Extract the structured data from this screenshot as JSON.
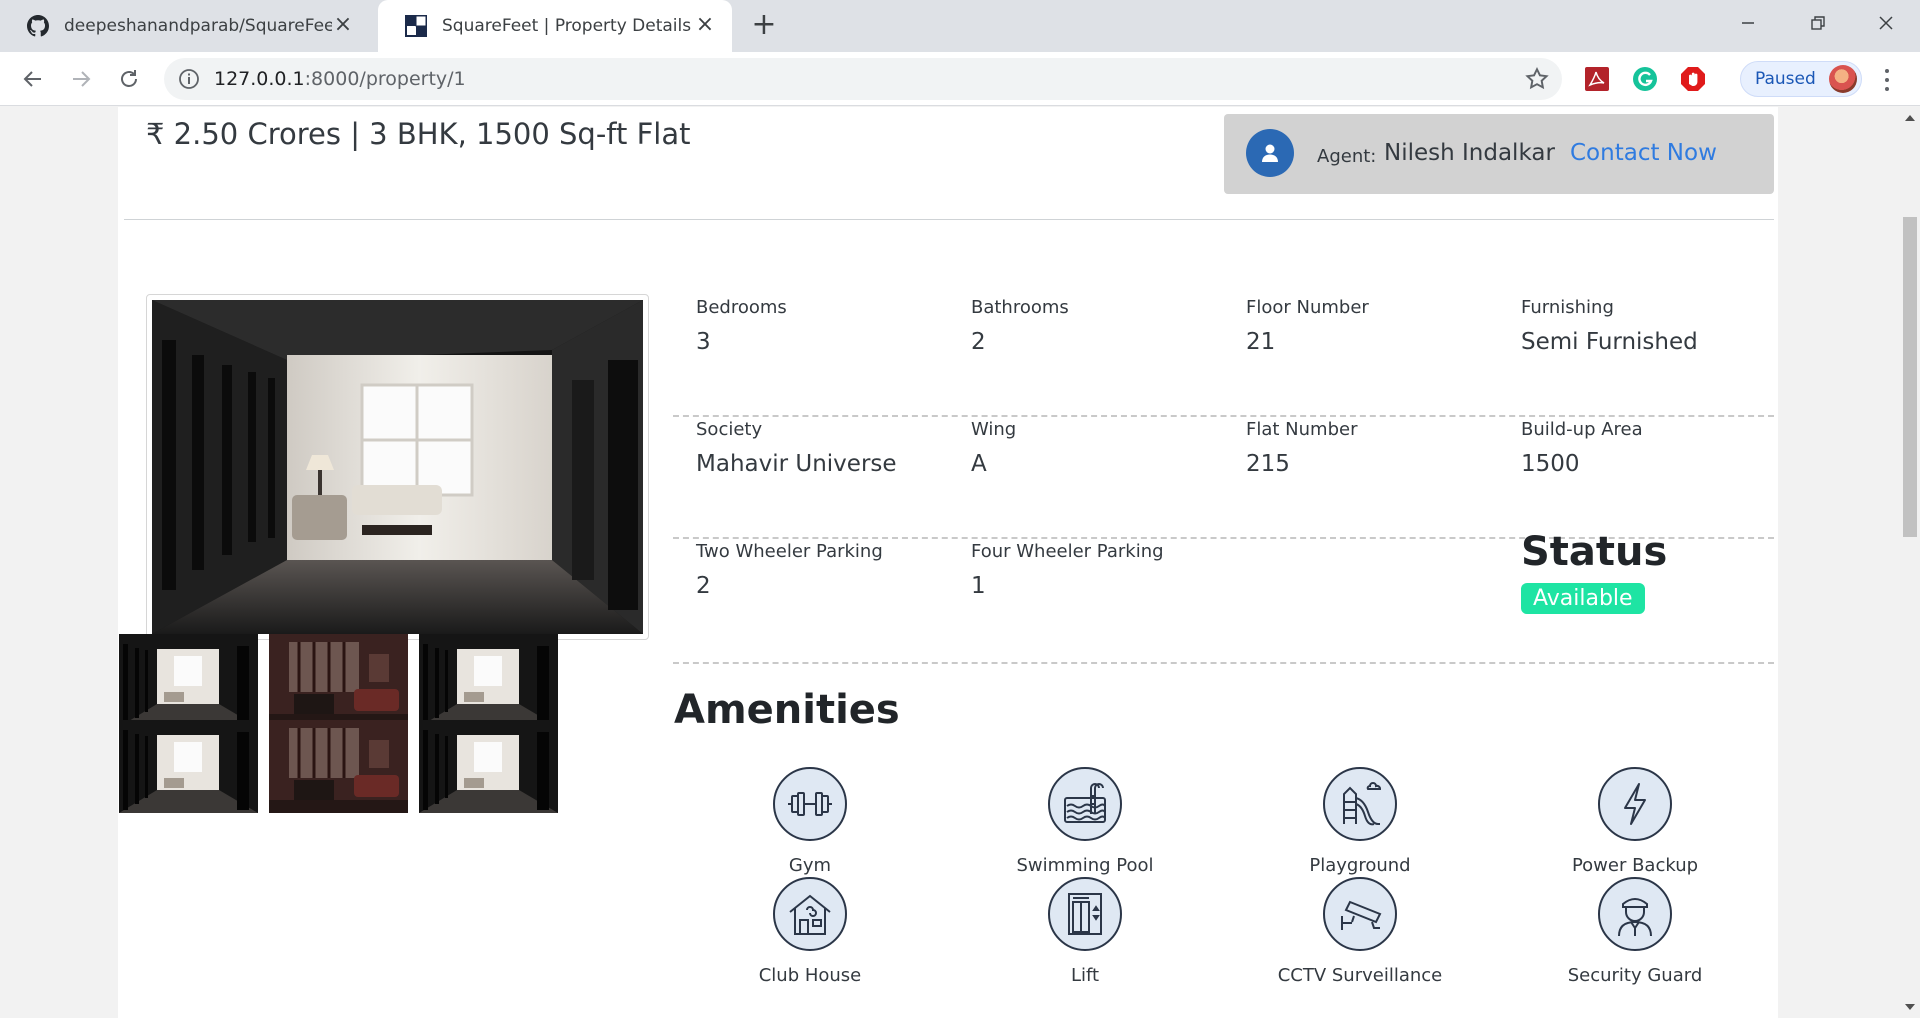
{
  "browser": {
    "tabs": [
      {
        "title": "deepeshanandparab/SquareFeet",
        "favicon": "github-icon",
        "active": false
      },
      {
        "title": "SquareFeet | Property Details",
        "favicon": "squarefeet-logo-icon",
        "active": true
      }
    ],
    "url_host": "127.0.0.1",
    "url_path": ":8000/property/1",
    "profile_status": "Paused",
    "extensions": [
      "acrobat-icon",
      "grammarly-icon",
      "adblock-icon"
    ]
  },
  "property": {
    "heading": "₹ 2.50 Crores | 3 BHK, 1500 Sq-ft Flat"
  },
  "agent": {
    "label": "Agent:",
    "name": "Nilesh Indalkar",
    "contact_label": "Contact Now"
  },
  "details": {
    "row1": [
      {
        "label": "Bedrooms",
        "value": "3"
      },
      {
        "label": "Bathrooms",
        "value": "2"
      },
      {
        "label": "Floor Number",
        "value": "21"
      },
      {
        "label": "Furnishing",
        "value": "Semi Furnished"
      }
    ],
    "row2": [
      {
        "label": "Society",
        "value": "Mahavir Universe"
      },
      {
        "label": "Wing",
        "value": "A"
      },
      {
        "label": "Flat Number",
        "value": "215"
      },
      {
        "label": "Build-up Area",
        "value": "1500"
      }
    ],
    "row3": [
      {
        "label": "Two Wheeler Parking",
        "value": "2"
      },
      {
        "label": "Four Wheeler Parking",
        "value": "1"
      }
    ],
    "status_title": "Status",
    "status_value": "Available"
  },
  "amenities": {
    "title": "Amenities",
    "items": [
      {
        "label": "Gym",
        "icon": "dumbbell-icon"
      },
      {
        "label": "Swimming Pool",
        "icon": "pool-icon"
      },
      {
        "label": "Playground",
        "icon": "slide-icon"
      },
      {
        "label": "Power Backup",
        "icon": "lightning-icon"
      },
      {
        "label": "Club House",
        "icon": "clubhouse-icon"
      },
      {
        "label": "Lift",
        "icon": "elevator-icon"
      },
      {
        "label": "CCTV Surveillance",
        "icon": "cctv-icon"
      },
      {
        "label": "Security Guard",
        "icon": "guard-icon"
      }
    ]
  },
  "colors": {
    "status_badge": "#1ee4a3",
    "contact_link": "#2f7be0",
    "agent_avatar": "#2b69b4",
    "agent_card": "#d2d2d2"
  }
}
